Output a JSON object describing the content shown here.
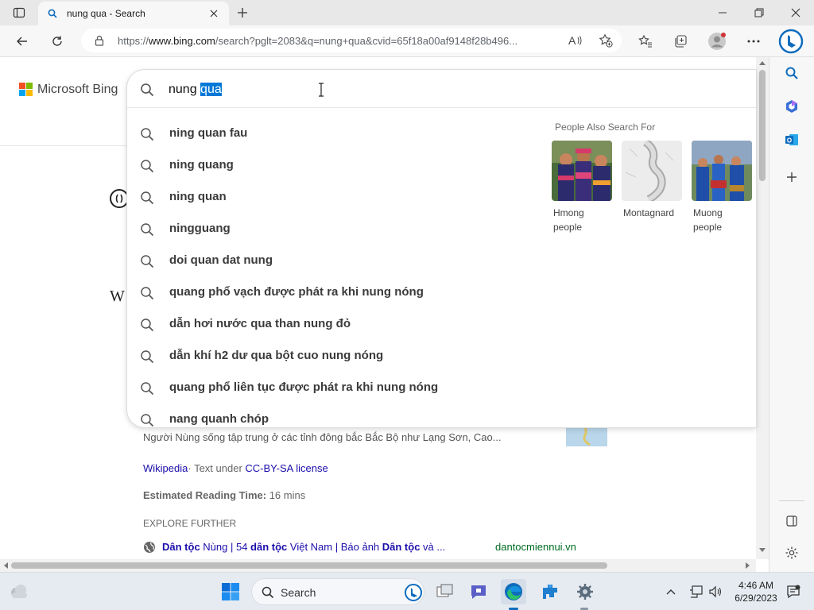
{
  "tab": {
    "title": "nung qua - Search"
  },
  "address": {
    "url_prefix": "https://",
    "url_host": "www.bing.com",
    "url_rest": "/search?pglt=2083&q=nung+qua&cvid=65f18a00af9148f28b496..."
  },
  "bing": {
    "logo_text": "Microsoft Bing"
  },
  "search": {
    "query_plain": "nung ",
    "query_selected": "qua",
    "suggestions": [
      "ning quan fau",
      "ning quang",
      "ning quan",
      "ningguang",
      "doi quan dat nung",
      "quang phổ vạch được phát ra khi nung nóng",
      "dẫn hơi nước qua than nung đỏ",
      "dẫn khí h2 dư qua bột cuo nung nóng",
      "quang phổ liên tục được phát ra khi nung nóng",
      "nang quanh chóp"
    ],
    "people_also_search_title": "People Also Search For",
    "people_also_search": [
      {
        "label": "Hmong people"
      },
      {
        "label": "Montagnard"
      },
      {
        "label": "Muong people"
      }
    ]
  },
  "page": {
    "snippet": "Người Nùng sống tập trung ở các tỉnh đông bắc Bắc Bộ như Lạng Sơn, Cao...",
    "wiki_source": "Wikipedia",
    "license_prefix": "· Text under ",
    "license_link": "CC-BY-SA license",
    "reading_label": "Estimated Reading Time:",
    "reading_value": "16 mins",
    "explore_further": "EXPLORE FURTHER",
    "explore_link_b1": "Dân tộc",
    "explore_link_t1": " Nùng | 54 ",
    "explore_link_b2": "dân tộc",
    "explore_link_t2": " Việt Nam | Báo ảnh ",
    "explore_link_b3": "Dân tộc",
    "explore_link_t3": " và ...",
    "explore_domain": "dantocmiennui.vn",
    "partial_w": "W"
  },
  "taskbar": {
    "search_label": "Search",
    "time": "4:46 AM",
    "date": "6/29/2023"
  },
  "colors": {
    "selection": "#0078d7",
    "edge_blue": "#0f6cbd"
  },
  "icons": [
    "sidebar-toggle-icon",
    "search-icon",
    "new-tab-icon",
    "minimize-icon",
    "restore-icon",
    "close-icon",
    "back-icon",
    "refresh-icon",
    "lock-icon",
    "read-aloud-icon",
    "favorite-add-icon",
    "favorites-icon",
    "collections-icon",
    "profile-icon",
    "more-icon",
    "bing-copilot-icon",
    "outlook-icon",
    "office-icon",
    "add-icon",
    "settings-icon",
    "windows-start-icon",
    "edge-icon"
  ]
}
